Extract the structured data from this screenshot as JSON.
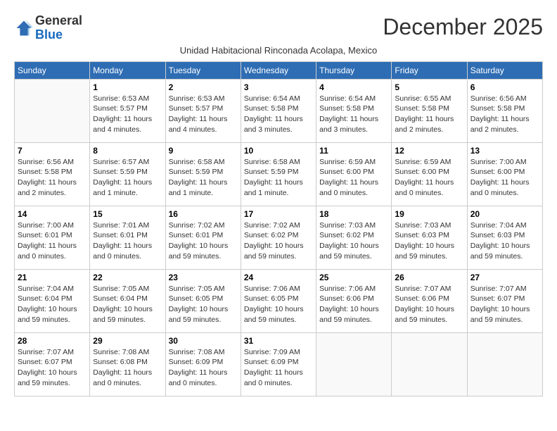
{
  "logo": {
    "general": "General",
    "blue": "Blue"
  },
  "title": "December 2025",
  "subtitle": "Unidad Habitacional Rinconada Acolapa, Mexico",
  "days_of_week": [
    "Sunday",
    "Monday",
    "Tuesday",
    "Wednesday",
    "Thursday",
    "Friday",
    "Saturday"
  ],
  "weeks": [
    [
      {
        "day": "",
        "sunrise": "",
        "sunset": "",
        "daylight": ""
      },
      {
        "day": "1",
        "sunrise": "Sunrise: 6:53 AM",
        "sunset": "Sunset: 5:57 PM",
        "daylight": "Daylight: 11 hours and 4 minutes."
      },
      {
        "day": "2",
        "sunrise": "Sunrise: 6:53 AM",
        "sunset": "Sunset: 5:57 PM",
        "daylight": "Daylight: 11 hours and 4 minutes."
      },
      {
        "day": "3",
        "sunrise": "Sunrise: 6:54 AM",
        "sunset": "Sunset: 5:58 PM",
        "daylight": "Daylight: 11 hours and 3 minutes."
      },
      {
        "day": "4",
        "sunrise": "Sunrise: 6:54 AM",
        "sunset": "Sunset: 5:58 PM",
        "daylight": "Daylight: 11 hours and 3 minutes."
      },
      {
        "day": "5",
        "sunrise": "Sunrise: 6:55 AM",
        "sunset": "Sunset: 5:58 PM",
        "daylight": "Daylight: 11 hours and 2 minutes."
      },
      {
        "day": "6",
        "sunrise": "Sunrise: 6:56 AM",
        "sunset": "Sunset: 5:58 PM",
        "daylight": "Daylight: 11 hours and 2 minutes."
      }
    ],
    [
      {
        "day": "7",
        "sunrise": "Sunrise: 6:56 AM",
        "sunset": "Sunset: 5:58 PM",
        "daylight": "Daylight: 11 hours and 2 minutes."
      },
      {
        "day": "8",
        "sunrise": "Sunrise: 6:57 AM",
        "sunset": "Sunset: 5:59 PM",
        "daylight": "Daylight: 11 hours and 1 minute."
      },
      {
        "day": "9",
        "sunrise": "Sunrise: 6:58 AM",
        "sunset": "Sunset: 5:59 PM",
        "daylight": "Daylight: 11 hours and 1 minute."
      },
      {
        "day": "10",
        "sunrise": "Sunrise: 6:58 AM",
        "sunset": "Sunset: 5:59 PM",
        "daylight": "Daylight: 11 hours and 1 minute."
      },
      {
        "day": "11",
        "sunrise": "Sunrise: 6:59 AM",
        "sunset": "Sunset: 6:00 PM",
        "daylight": "Daylight: 11 hours and 0 minutes."
      },
      {
        "day": "12",
        "sunrise": "Sunrise: 6:59 AM",
        "sunset": "Sunset: 6:00 PM",
        "daylight": "Daylight: 11 hours and 0 minutes."
      },
      {
        "day": "13",
        "sunrise": "Sunrise: 7:00 AM",
        "sunset": "Sunset: 6:00 PM",
        "daylight": "Daylight: 11 hours and 0 minutes."
      }
    ],
    [
      {
        "day": "14",
        "sunrise": "Sunrise: 7:00 AM",
        "sunset": "Sunset: 6:01 PM",
        "daylight": "Daylight: 11 hours and 0 minutes."
      },
      {
        "day": "15",
        "sunrise": "Sunrise: 7:01 AM",
        "sunset": "Sunset: 6:01 PM",
        "daylight": "Daylight: 11 hours and 0 minutes."
      },
      {
        "day": "16",
        "sunrise": "Sunrise: 7:02 AM",
        "sunset": "Sunset: 6:01 PM",
        "daylight": "Daylight: 10 hours and 59 minutes."
      },
      {
        "day": "17",
        "sunrise": "Sunrise: 7:02 AM",
        "sunset": "Sunset: 6:02 PM",
        "daylight": "Daylight: 10 hours and 59 minutes."
      },
      {
        "day": "18",
        "sunrise": "Sunrise: 7:03 AM",
        "sunset": "Sunset: 6:02 PM",
        "daylight": "Daylight: 10 hours and 59 minutes."
      },
      {
        "day": "19",
        "sunrise": "Sunrise: 7:03 AM",
        "sunset": "Sunset: 6:03 PM",
        "daylight": "Daylight: 10 hours and 59 minutes."
      },
      {
        "day": "20",
        "sunrise": "Sunrise: 7:04 AM",
        "sunset": "Sunset: 6:03 PM",
        "daylight": "Daylight: 10 hours and 59 minutes."
      }
    ],
    [
      {
        "day": "21",
        "sunrise": "Sunrise: 7:04 AM",
        "sunset": "Sunset: 6:04 PM",
        "daylight": "Daylight: 10 hours and 59 minutes."
      },
      {
        "day": "22",
        "sunrise": "Sunrise: 7:05 AM",
        "sunset": "Sunset: 6:04 PM",
        "daylight": "Daylight: 10 hours and 59 minutes."
      },
      {
        "day": "23",
        "sunrise": "Sunrise: 7:05 AM",
        "sunset": "Sunset: 6:05 PM",
        "daylight": "Daylight: 10 hours and 59 minutes."
      },
      {
        "day": "24",
        "sunrise": "Sunrise: 7:06 AM",
        "sunset": "Sunset: 6:05 PM",
        "daylight": "Daylight: 10 hours and 59 minutes."
      },
      {
        "day": "25",
        "sunrise": "Sunrise: 7:06 AM",
        "sunset": "Sunset: 6:06 PM",
        "daylight": "Daylight: 10 hours and 59 minutes."
      },
      {
        "day": "26",
        "sunrise": "Sunrise: 7:07 AM",
        "sunset": "Sunset: 6:06 PM",
        "daylight": "Daylight: 10 hours and 59 minutes."
      },
      {
        "day": "27",
        "sunrise": "Sunrise: 7:07 AM",
        "sunset": "Sunset: 6:07 PM",
        "daylight": "Daylight: 10 hours and 59 minutes."
      }
    ],
    [
      {
        "day": "28",
        "sunrise": "Sunrise: 7:07 AM",
        "sunset": "Sunset: 6:07 PM",
        "daylight": "Daylight: 10 hours and 59 minutes."
      },
      {
        "day": "29",
        "sunrise": "Sunrise: 7:08 AM",
        "sunset": "Sunset: 6:08 PM",
        "daylight": "Daylight: 11 hours and 0 minutes."
      },
      {
        "day": "30",
        "sunrise": "Sunrise: 7:08 AM",
        "sunset": "Sunset: 6:09 PM",
        "daylight": "Daylight: 11 hours and 0 minutes."
      },
      {
        "day": "31",
        "sunrise": "Sunrise: 7:09 AM",
        "sunset": "Sunset: 6:09 PM",
        "daylight": "Daylight: 11 hours and 0 minutes."
      },
      {
        "day": "",
        "sunrise": "",
        "sunset": "",
        "daylight": ""
      },
      {
        "day": "",
        "sunrise": "",
        "sunset": "",
        "daylight": ""
      },
      {
        "day": "",
        "sunrise": "",
        "sunset": "",
        "daylight": ""
      }
    ]
  ]
}
